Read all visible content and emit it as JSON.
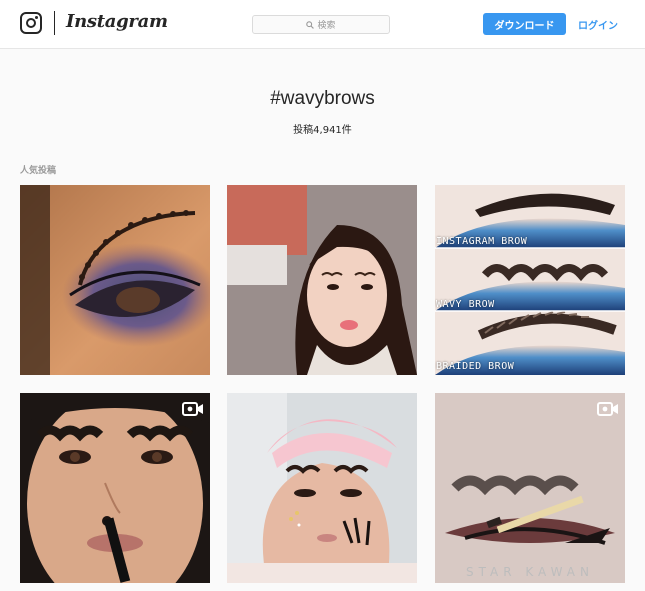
{
  "header": {
    "wordmark": "Instagram",
    "search_placeholder": "検索",
    "download_label": "ダウンロード",
    "login_label": "ログイン"
  },
  "tag": {
    "title": "#wavybrows",
    "post_count": "投稿4,941件"
  },
  "section": {
    "label": "人気投稿"
  },
  "posts": [
    {
      "kind": "photo",
      "icon": "none"
    },
    {
      "kind": "photo",
      "icon": "none"
    },
    {
      "kind": "photo",
      "icon": "none",
      "captions": [
        "INSTAGRAM BROW",
        "WAVY BROW",
        "BRAIDED BROW"
      ]
    },
    {
      "kind": "video",
      "icon": "video-camera-icon"
    },
    {
      "kind": "photo",
      "icon": "none"
    },
    {
      "kind": "video",
      "icon": "video-camera-icon",
      "watermark": "STAR KAWAN"
    }
  ],
  "colors": {
    "accent": "#3897f0",
    "text": "#262626",
    "muted": "#999999",
    "background": "#fafafa"
  }
}
